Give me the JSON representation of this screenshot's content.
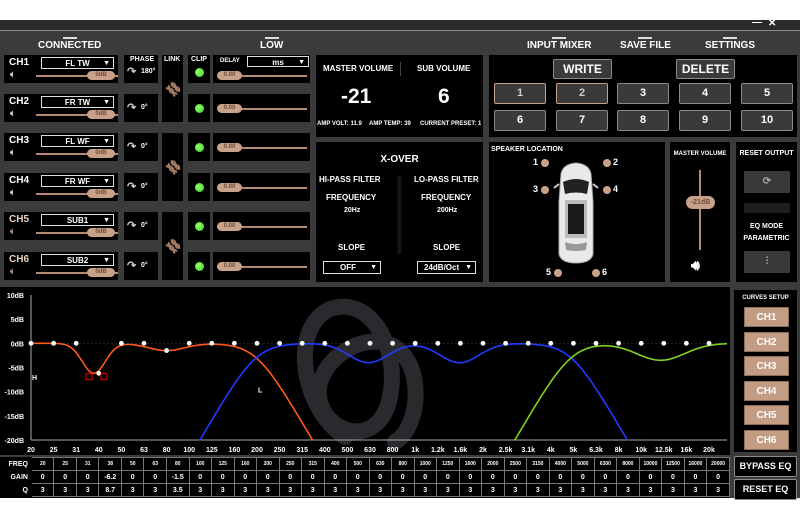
{
  "window": {
    "minimize": "—",
    "close": "✕"
  },
  "nav": {
    "connected": "CONNECTED",
    "low": "LOW",
    "input_mixer": "INPUT MIXER",
    "save_file": "SAVE FILE",
    "settings": "SETTINGS"
  },
  "channel_headers": {
    "phase": "PHASE",
    "link": "LINK",
    "clip": "CLIP",
    "delay": "DELAY",
    "delay_unit": "ms"
  },
  "channels": [
    {
      "name": "CH1",
      "speaker": "FL TW",
      "gain": "0dB",
      "phase": "180°",
      "delay": "0.00"
    },
    {
      "name": "CH2",
      "speaker": "FR TW",
      "gain": "0dB",
      "phase": "0°",
      "delay": "0.00"
    },
    {
      "name": "CH3",
      "speaker": "FL WF",
      "gain": "0dB",
      "phase": "0°",
      "delay": "0.00"
    },
    {
      "name": "CH4",
      "speaker": "FR WF",
      "gain": "0dB",
      "phase": "0°",
      "delay": "0.00"
    },
    {
      "name": "CH5",
      "speaker": "SUB1",
      "gain": "0dB",
      "phase": "0°",
      "delay": "0.00"
    },
    {
      "name": "CH6",
      "speaker": "SUB2",
      "gain": "0dB",
      "phase": "0°",
      "delay": "0.00"
    }
  ],
  "volume": {
    "master_label": "MASTER VOLUME",
    "sub_label": "SUB VOLUME",
    "master": "-21",
    "sub": "6",
    "amp_volt": "AMP VOLT: 11.9",
    "amp_temp": "AMP TEMP: 39",
    "current_preset": "CURRENT PRESET: 1"
  },
  "presets": {
    "write": "WRITE",
    "delete": "DELETE",
    "items": [
      "1",
      "2",
      "3",
      "4",
      "5",
      "6",
      "7",
      "8",
      "9",
      "10"
    ],
    "highlighted": [
      "1",
      "2"
    ]
  },
  "xover": {
    "title": "X-OVER",
    "hpf": "HI-PASS FILTER",
    "lpf": "LO-PASS FILTER",
    "freq_label": "FREQUENCY",
    "hpf_freq": "20Hz",
    "lpf_freq": "200Hz",
    "slope_label": "SLOPE",
    "hpf_slope": "OFF",
    "lpf_slope": "24dB/Oct"
  },
  "speaker_location": {
    "title": "SPEAKER LOCATION",
    "points": [
      "1",
      "2",
      "3",
      "4",
      "5",
      "6"
    ]
  },
  "master_slider": {
    "title": "MASTER VOLUME",
    "value": "-21dB"
  },
  "reset_panel": {
    "title": "RESET OUTPUT",
    "eq_mode": "EQ MODE",
    "eq_mode_value": "PARAMETRIC"
  },
  "curves_setup": {
    "title": "CURVES SETUP",
    "buttons": [
      "CH1",
      "CH2",
      "CH3",
      "CH4",
      "CH5",
      "CH6"
    ]
  },
  "eq_buttons": {
    "bypass": "BYPASS EQ",
    "reset": "RESET EQ"
  },
  "colors": {
    "accent": "#c9a088",
    "ch_a": "#ff5a1a",
    "ch_b": "#1f3cff",
    "ch_c": "#7ed321",
    "clip_led": "#66dd33"
  },
  "chart_data": {
    "type": "line",
    "xscale": "log",
    "ylim": [
      -20,
      10
    ],
    "y_ticks": [
      "10dB",
      "5dB",
      "0dB",
      "-5dB",
      "-10dB",
      "-15dB",
      "-20dB"
    ],
    "x_ticks": [
      "20",
      "25",
      "31",
      "40",
      "50",
      "63",
      "80",
      "100",
      "125",
      "160",
      "200",
      "250",
      "315",
      "400",
      "500",
      "630",
      "800",
      "1k",
      "1.2k",
      "1.6k",
      "2k",
      "2.5k",
      "3.1k",
      "4k",
      "5k",
      "6.3k",
      "8k",
      "10k",
      "12.5k",
      "16k",
      "20k"
    ],
    "annotations": [
      "H",
      "L"
    ],
    "series": [
      {
        "color": "#ff5a1a",
        "hpf_hz": null,
        "lpf_hz": 200,
        "order": 4,
        "bands": [
          {
            "f": 38,
            "gain": -6.2,
            "q": 8.7
          },
          {
            "f": 80,
            "gain": -1.5,
            "q": 3.5
          }
        ]
      },
      {
        "color": "#1f3cff",
        "hpf_hz": 200,
        "lpf_hz": 5000,
        "order": 4,
        "bands": [
          {
            "f": 630,
            "gain": -4,
            "q": 3
          },
          {
            "f": 1600,
            "gain": -4,
            "q": 3
          }
        ]
      },
      {
        "color": "#7ed321",
        "hpf_hz": 5000,
        "lpf_hz": null,
        "order": 4,
        "bands": [
          {
            "f": 12500,
            "gain": -3.5,
            "q": 2
          }
        ]
      }
    ]
  },
  "eq_table": {
    "row_labels": {
      "freq": "FREQ",
      "gain": "GAIN",
      "q": "Q"
    },
    "freq": [
      "20",
      "25",
      "31",
      "38",
      "50",
      "63",
      "80",
      "100",
      "125",
      "160",
      "200",
      "250",
      "315",
      "400",
      "500",
      "630",
      "800",
      "1000",
      "1250",
      "1600",
      "2000",
      "2500",
      "3150",
      "4000",
      "5000",
      "6300",
      "8000",
      "10000",
      "12500",
      "16000",
      "20000"
    ],
    "gain": [
      "0",
      "0",
      "0",
      "-6.2",
      "0",
      "0",
      "-1.5",
      "0",
      "0",
      "0",
      "0",
      "0",
      "0",
      "0",
      "0",
      "0",
      "0",
      "0",
      "0",
      "0",
      "0",
      "0",
      "0",
      "0",
      "0",
      "0",
      "0",
      "0",
      "0",
      "0",
      "0"
    ],
    "q": [
      "3",
      "3",
      "3",
      "8.7",
      "3",
      "3",
      "3.5",
      "3",
      "3",
      "3",
      "3",
      "3",
      "3",
      "3",
      "3",
      "3",
      "3",
      "3",
      "3",
      "3",
      "3",
      "3",
      "3",
      "3",
      "3",
      "3",
      "3",
      "3",
      "3",
      "3",
      "3"
    ]
  }
}
